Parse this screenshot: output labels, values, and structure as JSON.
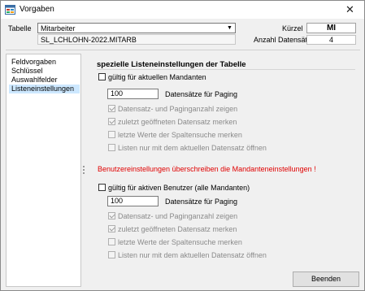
{
  "window": {
    "title": "Vorgaben"
  },
  "header": {
    "table_label": "Tabelle",
    "table_value": "Mitarbeiter",
    "table_path": "SL_LCHLOHN-2022.MITARB",
    "kuerzel_label": "Kürzel",
    "kuerzel_value": "MI",
    "count_label": "Anzahl Datensätze",
    "count_value": "4"
  },
  "sidebar": {
    "items": [
      {
        "label": "Feldvorgaben"
      },
      {
        "label": "Schlüssel"
      },
      {
        "label": "Auswahlfelder"
      },
      {
        "label": "Listeneinstellungen",
        "selected": true
      }
    ]
  },
  "panel": {
    "title": "spezielle Listeneinstellungen der Tabelle",
    "mandant": {
      "checkbox_label": "gültig für aktuellen Mandanten",
      "paging_value": "100",
      "paging_label": "Datensätze für Paging",
      "options": [
        {
          "label": "Datensatz- und Paginganzahl zeigen",
          "checked": true
        },
        {
          "label": "zuletzt geöffneten Datensatz merken",
          "checked": true
        },
        {
          "label": "letzte Werte der Spaltensuche merken",
          "checked": false
        },
        {
          "label": "Listen nur mit dem aktuellen Datensatz öffnen",
          "checked": false
        }
      ]
    },
    "warning": "Benutzereinstellungen überschreiben die Mandanteneinstellungen !",
    "benutzer": {
      "checkbox_label": "gültig für aktiven Benutzer (alle Mandanten)",
      "paging_value": "100",
      "paging_label": "Datensätze für Paging",
      "options": [
        {
          "label": "Datensatz- und Paginganzahl zeigen",
          "checked": true
        },
        {
          "label": "zuletzt geöffneten Datensatz merken",
          "checked": true
        },
        {
          "label": "letzte Werte der Spaltensuche merken",
          "checked": false
        },
        {
          "label": "Listen nur mit dem aktuellen Datensatz öffnen",
          "checked": false
        }
      ]
    }
  },
  "footer": {
    "close_button": "Beenden"
  },
  "icons": {
    "app": "app-window-icon",
    "close": "close-icon",
    "dropdown": "chevron-down-icon"
  }
}
